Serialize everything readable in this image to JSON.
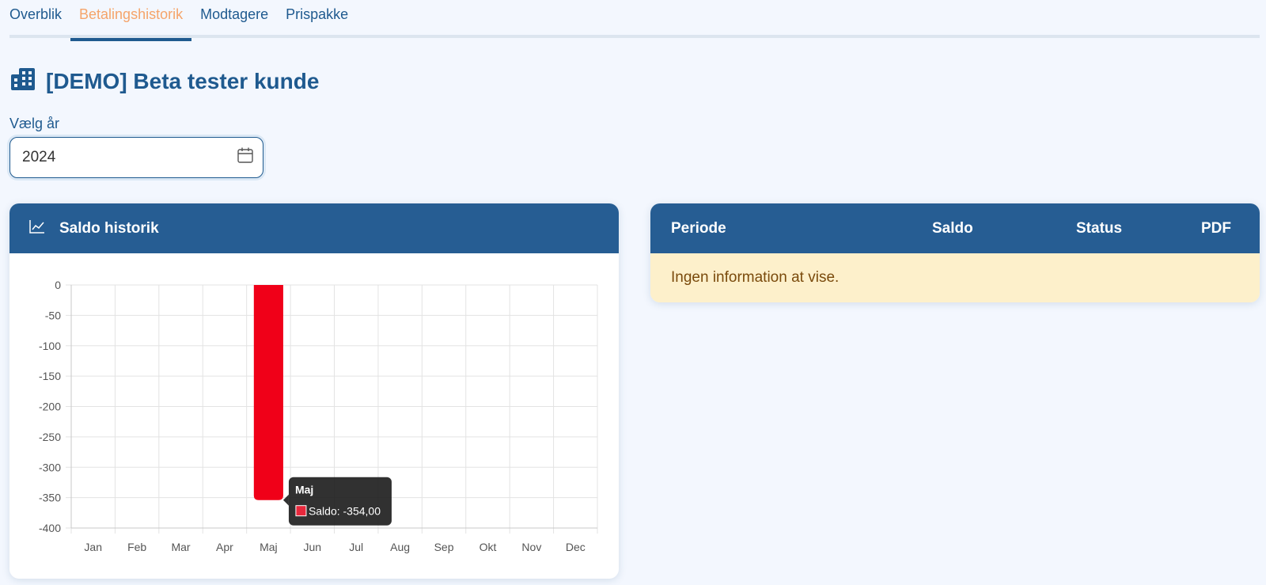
{
  "tabs": [
    {
      "label": "Overblik",
      "active": false
    },
    {
      "label": "Betalingshistorik",
      "active": true
    },
    {
      "label": "Modtagere",
      "active": false
    },
    {
      "label": "Prispakke",
      "active": false
    }
  ],
  "page": {
    "title": "[DEMO] Beta tester kunde",
    "icon": "building-icon"
  },
  "year_select": {
    "label": "Vælg år",
    "value": "2024",
    "icon": "calendar-icon"
  },
  "chart_card": {
    "title": "Saldo historik",
    "icon": "line-chart-icon"
  },
  "table_card": {
    "columns": [
      "Periode",
      "Saldo",
      "Status",
      "PDF"
    ],
    "empty_message": "Ingen information at vise."
  },
  "tooltip": {
    "title": "Maj",
    "label": "Saldo: -354,00",
    "color": "#e8283c"
  },
  "colors": {
    "accent": "#265d93",
    "active_tab": "#f5a46a",
    "bar": "#f00018",
    "alert_bg": "#fdf0cb"
  },
  "chart_data": {
    "type": "bar",
    "categories": [
      "Jan",
      "Feb",
      "Mar",
      "Apr",
      "Maj",
      "Jun",
      "Jul",
      "Aug",
      "Sep",
      "Okt",
      "Nov",
      "Dec"
    ],
    "series": [
      {
        "name": "Saldo",
        "values": [
          0,
          0,
          0,
          0,
          -354,
          0,
          0,
          0,
          0,
          0,
          0,
          0
        ]
      }
    ],
    "ylim": [
      -400,
      0
    ],
    "yticks": [
      0,
      -50,
      -100,
      -150,
      -200,
      -250,
      -300,
      -350,
      -400
    ],
    "grid": true
  }
}
